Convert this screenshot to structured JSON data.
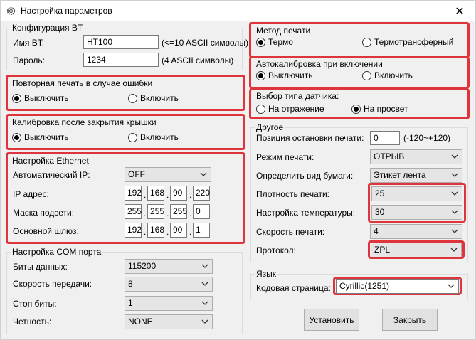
{
  "window": {
    "title": "Настройка параметров",
    "close_glyph": "✕"
  },
  "bt": {
    "title": "Конфигурация BT",
    "name_label": "Имя BT:",
    "name_value": "HT100",
    "name_hint": "(<=10 ASCII символы)",
    "password_label": "Пароль:",
    "password_value": "1234",
    "password_hint": "(4 ASCII символы)"
  },
  "reprint": {
    "title": "Повторная печать в случае ошибки",
    "off": "Выключить",
    "on": "Включить",
    "selected": "off"
  },
  "calib_cover": {
    "title": "Калибровка после закрытия крышки",
    "off": "Выключить",
    "on": "Включить",
    "selected": "off"
  },
  "ethernet": {
    "title": "Настройка Ethernet",
    "auto_ip_label": "Автоматический IP:",
    "auto_ip_value": "OFF",
    "ip_label": "IP адрес:",
    "ip": [
      "192",
      "168",
      "90",
      "220"
    ],
    "mask_label": "Маска подсети:",
    "mask": [
      "255",
      "255",
      "255",
      "0"
    ],
    "gateway_label": "Основной шлюз:",
    "gateway": [
      "192",
      "168",
      "90",
      "1"
    ]
  },
  "com": {
    "title": "Настройка COM порта",
    "databits_label": "Биты данных:",
    "databits_value": "115200",
    "baud_label": "Скорость передачи:",
    "baud_value": "8",
    "stopbits_label": "Стоп биты:",
    "stopbits_value": "1",
    "parity_label": "Четность:",
    "parity_value": "NONE"
  },
  "print_method": {
    "title": "Метод печати",
    "thermo": "Термо",
    "transfer": "Термотрансферный",
    "selected": "thermo"
  },
  "autocalib": {
    "title": "Автокалибровка при включении",
    "off": "Выключить",
    "on": "Включить",
    "selected": "off"
  },
  "sensor": {
    "title": "Выбор типа датчика:",
    "reflect": "На отражение",
    "through": "На просвет",
    "selected": "through"
  },
  "other": {
    "title": "Другое",
    "stop_pos_label": "Позиция остановки печати:",
    "stop_pos_value": "0",
    "stop_pos_range": "(-120~+120)",
    "mode_label": "Режим печати:",
    "mode_value": "ОТРЫВ",
    "paper_label": "Определить вид бумаги:",
    "paper_value": "Этикет лента",
    "density_label": "Плотность печати:",
    "density_value": "25",
    "temp_label": "Настройка температуры:",
    "temp_value": "30",
    "speed_label": "Скорость печати:",
    "speed_value": "4",
    "protocol_label": "Протокол:",
    "protocol_value": "ZPL"
  },
  "language": {
    "title": "Язык",
    "codepage_label": "Кодовая страница:",
    "codepage_value": "Cyrillic(1251)"
  },
  "buttons": {
    "apply": "Установить",
    "close": "Закрыть"
  },
  "colors": {
    "highlight": "#e0343c",
    "window_bg": "#f0f0f0"
  }
}
